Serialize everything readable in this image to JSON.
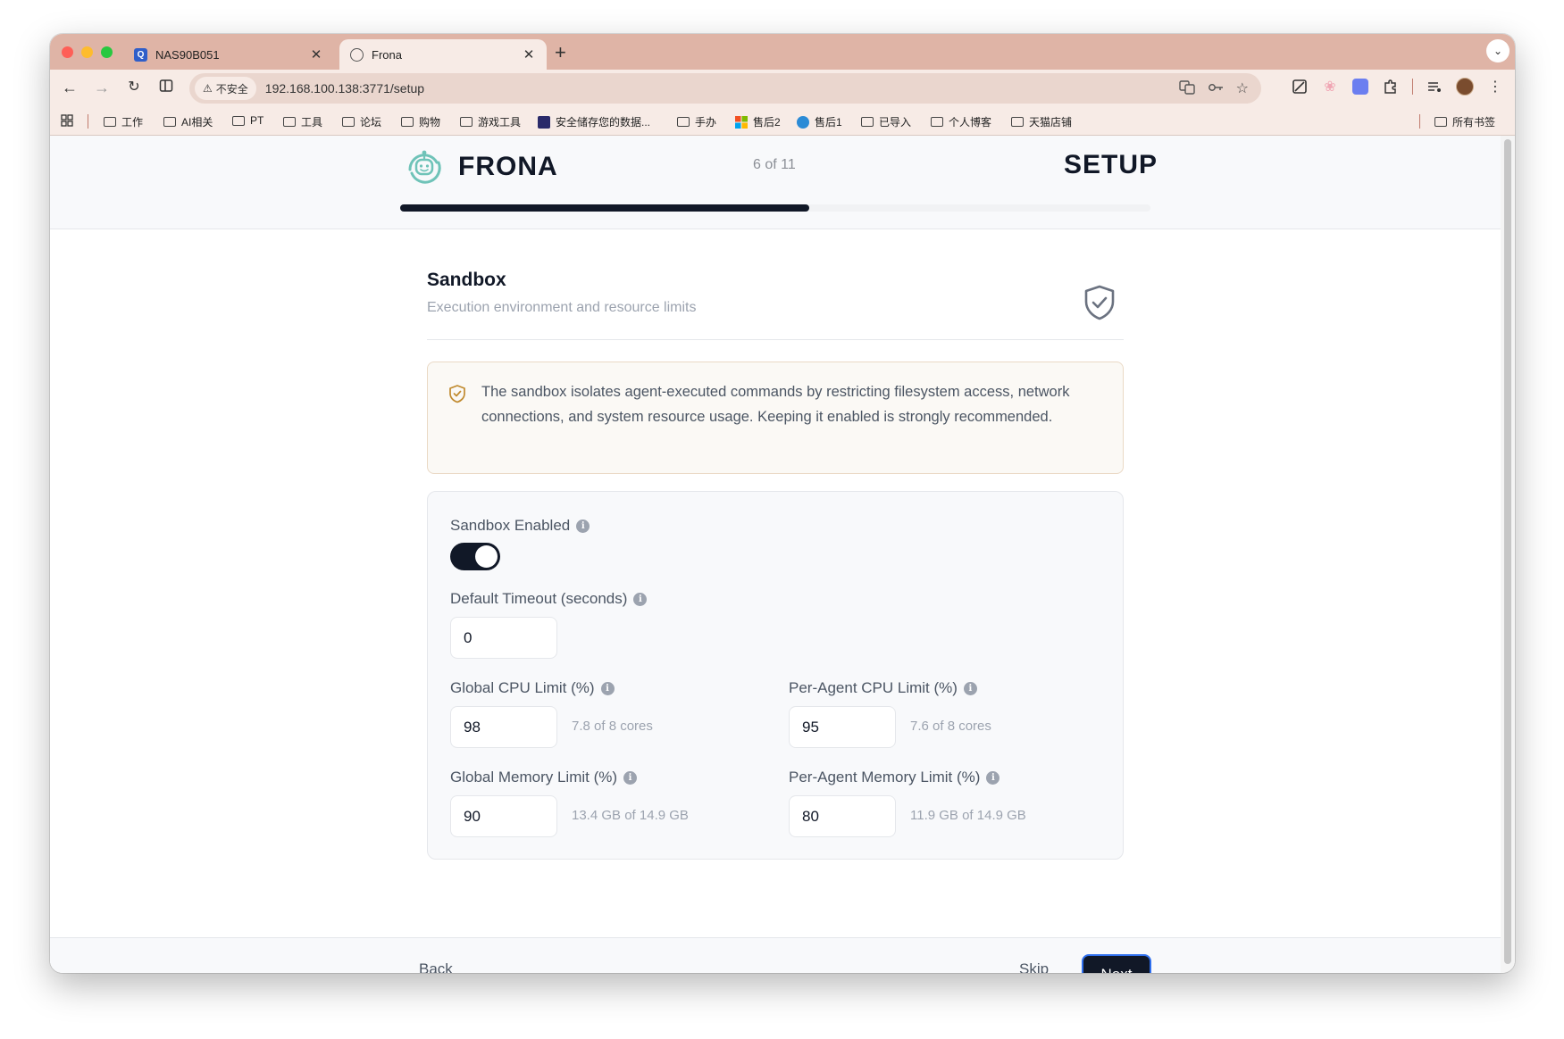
{
  "browser": {
    "tabs": [
      {
        "title": "NAS90B051",
        "icon": "nas-icon"
      },
      {
        "title": "Frona",
        "icon": "globe-icon",
        "active": true
      }
    ],
    "security_label": "不安全",
    "url": "192.168.100.138:3771/setup",
    "bookmarks": [
      "工作",
      "AI相关",
      "PT",
      "工具",
      "论坛",
      "购物",
      "游戏工具",
      "安全储存您的数据...",
      "手办",
      "售后2",
      "售后1",
      "已导入",
      "个人博客",
      "天猫店铺"
    ],
    "all_bookmarks": "所有书签"
  },
  "header": {
    "brand": "FRONA",
    "step_text": "6 of 11",
    "title": "SETUP",
    "progress": 0.545
  },
  "section": {
    "title": "Sandbox",
    "subtitle": "Execution environment and resource limits"
  },
  "notice": {
    "text": "The sandbox isolates agent-executed commands by restricting filesystem access, network connections, and system resource usage. Keeping it enabled is strongly recommended."
  },
  "form": {
    "sandbox_enabled": {
      "label": "Sandbox Enabled",
      "value": true
    },
    "default_timeout": {
      "label": "Default Timeout (seconds)",
      "value": "0"
    },
    "global_cpu": {
      "label": "Global CPU Limit (%)",
      "value": "98",
      "hint": "7.8 of 8 cores"
    },
    "per_agent_cpu": {
      "label": "Per-Agent CPU Limit (%)",
      "value": "95",
      "hint": "7.6 of 8 cores"
    },
    "global_memory": {
      "label": "Global Memory Limit (%)",
      "value": "90",
      "hint": "13.4 GB of 14.9 GB"
    },
    "per_agent_memory": {
      "label": "Per-Agent Memory Limit (%)",
      "value": "80",
      "hint": "11.9 GB of 14.9 GB"
    }
  },
  "footer": {
    "back": "Back",
    "skip": "Skip",
    "next": "Next"
  },
  "colors": {
    "accent": "#111827",
    "tabstrip": "#dfb4a6",
    "next_border": "#2f6fed",
    "notice_bg": "#fbf9f5"
  }
}
